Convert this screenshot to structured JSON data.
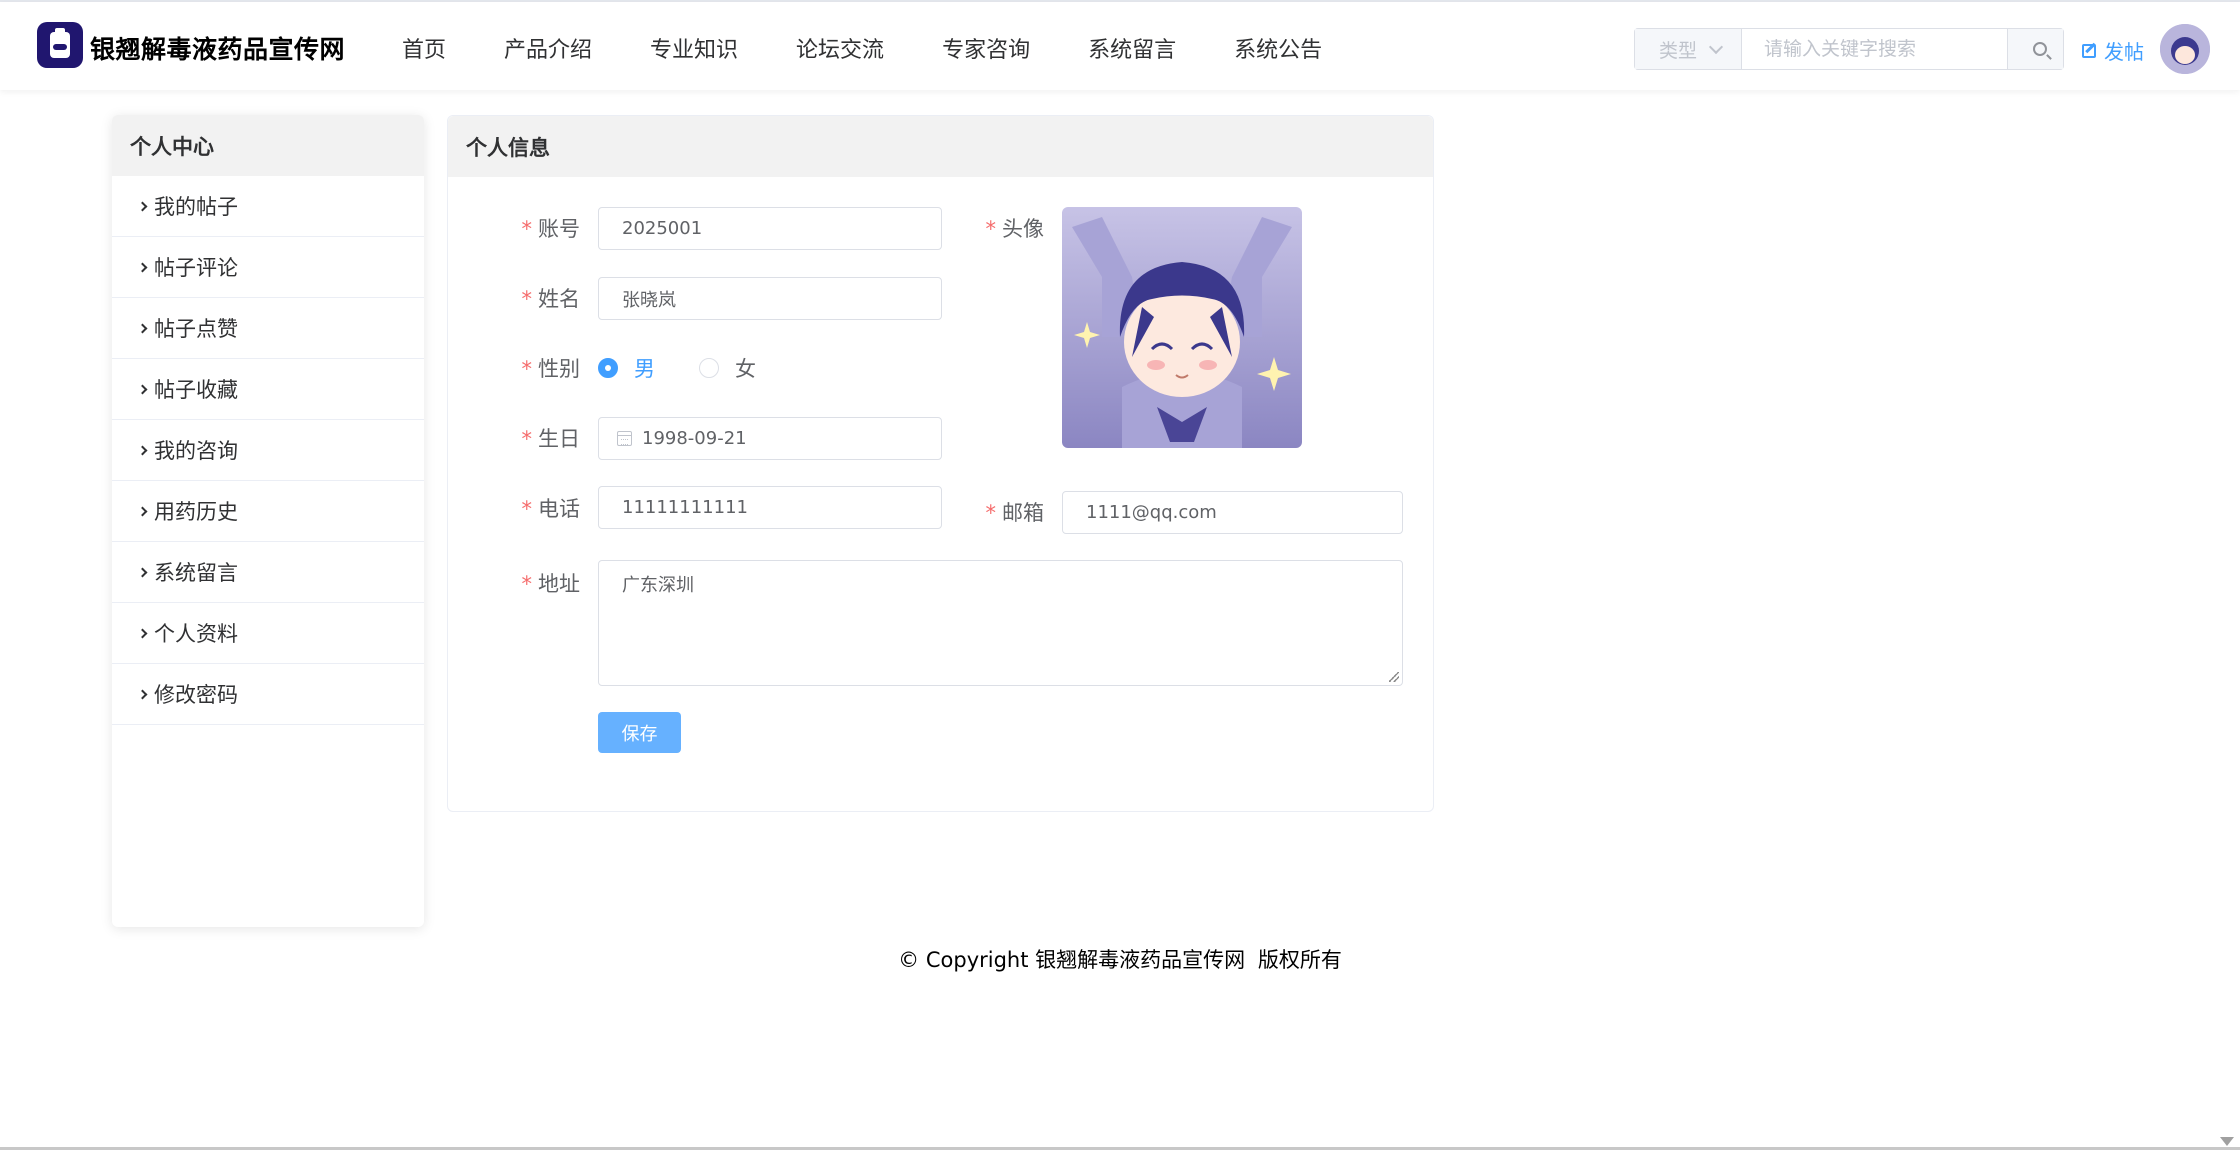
{
  "header": {
    "site_title": "银翘解毒液药品宣传网",
    "nav": [
      "首页",
      "产品介绍",
      "专业知识",
      "论坛交流",
      "专家咨询",
      "系统留言",
      "系统公告"
    ],
    "search_type": "类型",
    "search_placeholder": "请输入关键字搜索",
    "post_label": "发帖"
  },
  "sidebar": {
    "title": "个人中心",
    "items": [
      "我的帖子",
      "帖子评论",
      "帖子点赞",
      "帖子收藏",
      "我的咨询",
      "用药历史",
      "系统留言",
      "个人资料",
      "修改密码"
    ]
  },
  "profile": {
    "title": "个人信息",
    "account_label": "账号",
    "account": "2025001",
    "name_label": "姓名",
    "name": "张晓岚",
    "gender_label": "性别",
    "gender_options": [
      "男",
      "女"
    ],
    "gender_selected": "男",
    "birthday_label": "生日",
    "birthday": "1998-09-21",
    "phone_label": "电话",
    "phone": "11111111111",
    "avatar_label": "头像",
    "email_label": "邮箱",
    "email": "1111@qq.com",
    "address_label": "地址",
    "address": "广东深圳",
    "save_label": "保存"
  },
  "footer": {
    "copyright": "© Copyright 银翘解毒液药品宣传网",
    "rights": "版权所有"
  },
  "colors": {
    "accent": "#409eff",
    "logo_bg": "#20166f",
    "required": "#f56c6c"
  }
}
